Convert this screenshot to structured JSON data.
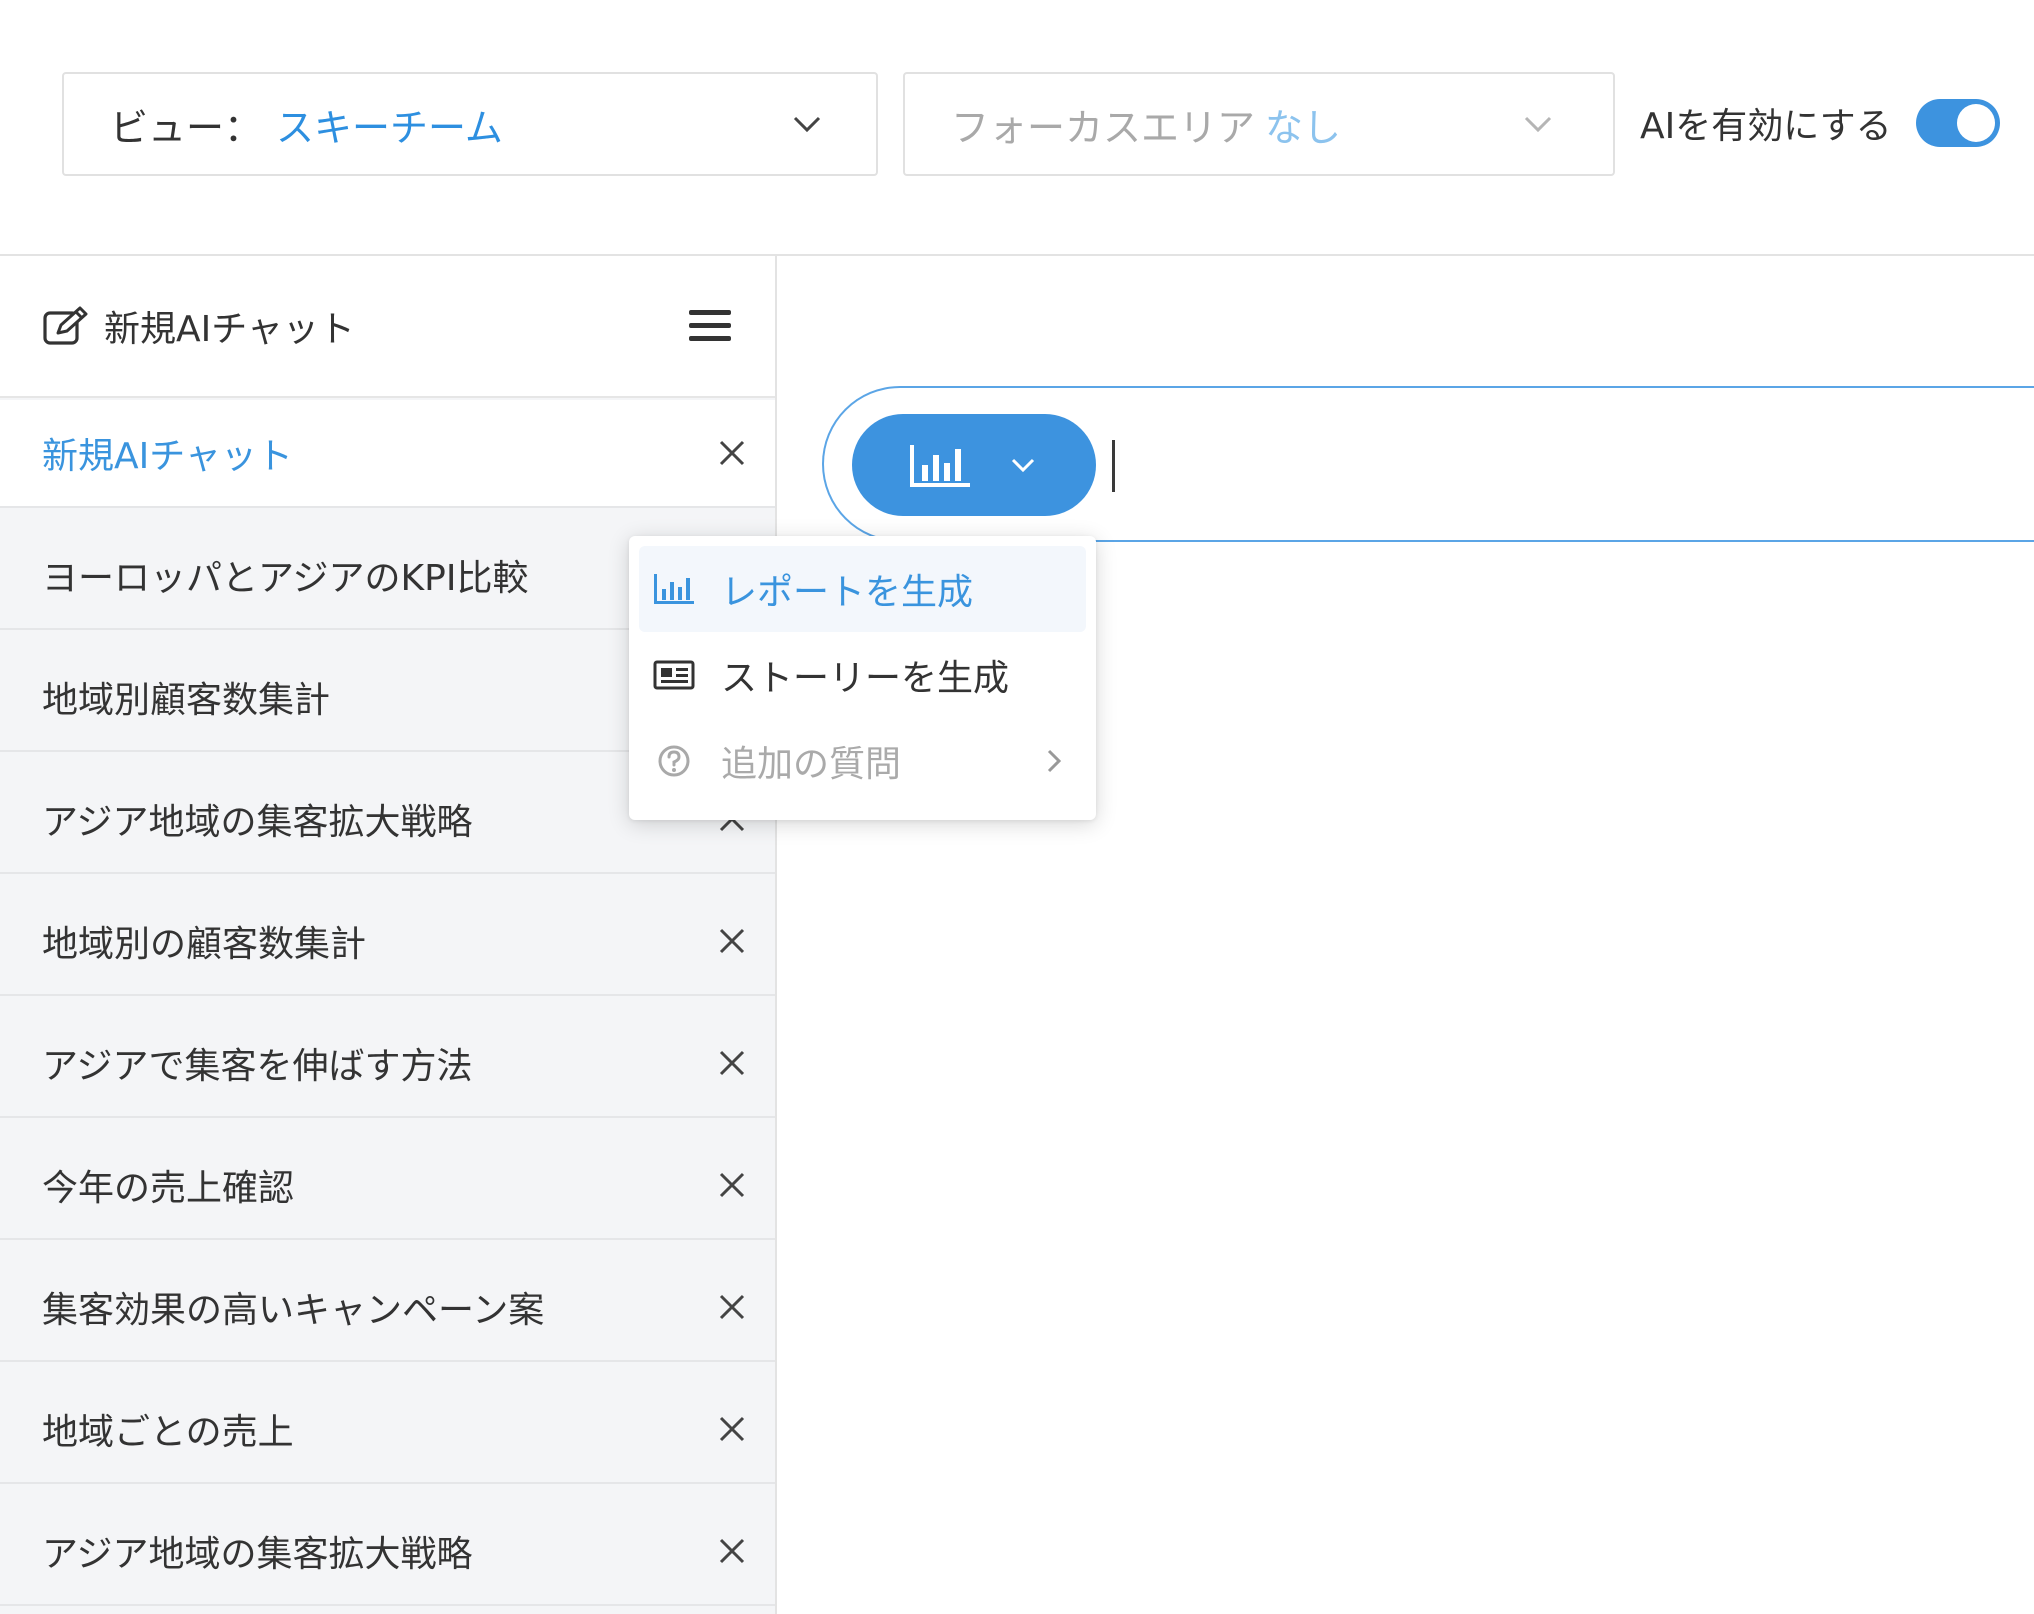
{
  "header": {
    "view_label": "ビュー：",
    "view_value": "スキーチーム",
    "focus_label": "フォーカスエリア",
    "focus_value": "なし",
    "ai_toggle_label": "AIを有効にする",
    "ai_enabled": true
  },
  "sidebar": {
    "new_chat_label": "新規AIチャット",
    "chats": [
      {
        "title": "新規AIチャット",
        "active": true
      },
      {
        "title": "ヨーロッパとアジアのKPI比較"
      },
      {
        "title": "地域別顧客数集計"
      },
      {
        "title": "アジア地域の集客拡大戦略"
      },
      {
        "title": "地域別の顧客数集計"
      },
      {
        "title": "アジアで集客を伸ばす方法"
      },
      {
        "title": "今年の売上確認"
      },
      {
        "title": "集客効果の高いキャンペーン案"
      },
      {
        "title": "地域ごとの売上"
      },
      {
        "title": "アジア地域の集客拡大戦略"
      }
    ]
  },
  "dropdown": {
    "items": [
      {
        "label": "レポートを生成",
        "icon": "bar-chart-icon",
        "highlighted": true
      },
      {
        "label": "ストーリーを生成",
        "icon": "newspaper-icon"
      },
      {
        "label": "追加の質問",
        "icon": "question-circle-icon",
        "disabled": true,
        "has_submenu": true
      }
    ]
  },
  "colors": {
    "accent": "#3d93df",
    "accent_text": "#3a94de",
    "sidebar_bg": "#f4f5f7",
    "border": "#e3e3e3"
  }
}
